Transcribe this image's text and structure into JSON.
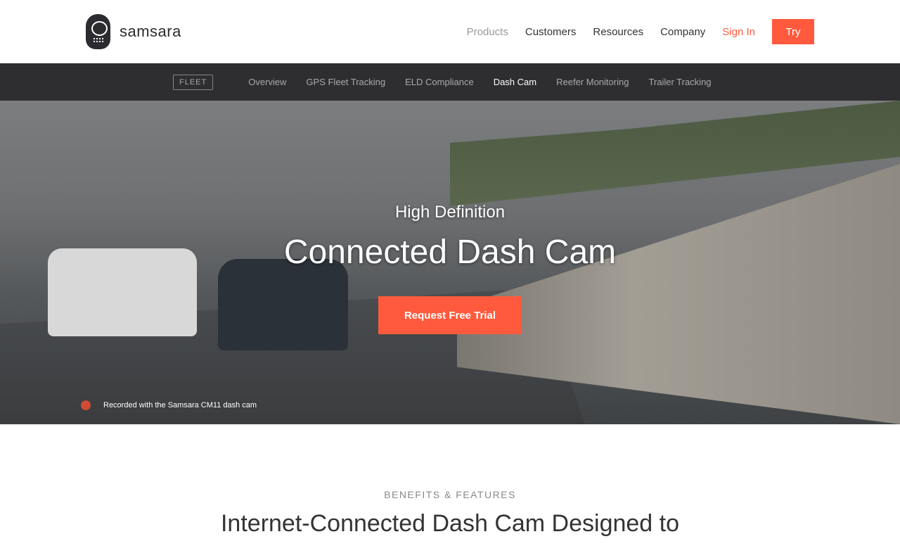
{
  "brand": "samsara",
  "nav": {
    "items": [
      "Products",
      "Customers",
      "Resources",
      "Company"
    ],
    "signin": "Sign In",
    "try": "Try"
  },
  "subnav": {
    "tag": "FLEET",
    "items": [
      "Overview",
      "GPS Fleet Tracking",
      "ELD Compliance",
      "Dash Cam",
      "Reefer Monitoring",
      "Trailer Tracking"
    ]
  },
  "hero": {
    "eyebrow": "High Definition",
    "title": "Connected Dash Cam",
    "cta": "Request Free Trial",
    "caption": "Recorded with the Samsara CM11 dash cam"
  },
  "section": {
    "eyebrow": "BENEFITS & FEATURES",
    "title": "Internet-Connected Dash Cam Designed to"
  },
  "colors": {
    "accent": "#ff5a3d",
    "subnav": "#2e2d30"
  }
}
